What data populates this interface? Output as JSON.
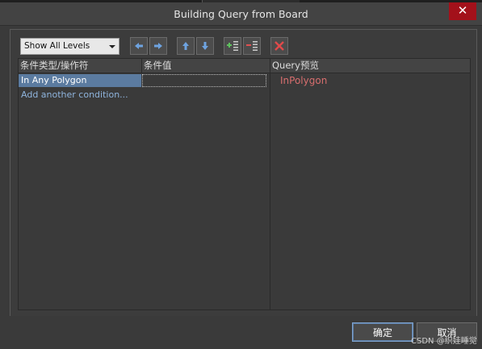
{
  "window": {
    "title": "Building Query from Board",
    "close_glyph": "✕"
  },
  "toolbar": {
    "level_select": "Show All Levels",
    "buttons": [
      "arrow-left-icon",
      "arrow-right-icon",
      "arrow-up-icon",
      "arrow-down-icon",
      "add-row-icon",
      "remove-row-icon",
      "delete-icon"
    ]
  },
  "conditions": {
    "headers": [
      "条件类型/操作符",
      "条件值"
    ],
    "rows": [
      {
        "type": "In Any Polygon",
        "value": ""
      }
    ],
    "add_link": "Add another condition..."
  },
  "preview": {
    "header": "Query预览",
    "text": "InPolygon"
  },
  "footer": {
    "ok_label": "确定",
    "cancel_label": "取消"
  },
  "watermark": "CSDN @织娃睡觉",
  "colors": {
    "selection": "#5b7ba0",
    "query_text": "#d86e6e",
    "close_bg": "#a3111a",
    "link": "#8fb4dd"
  }
}
